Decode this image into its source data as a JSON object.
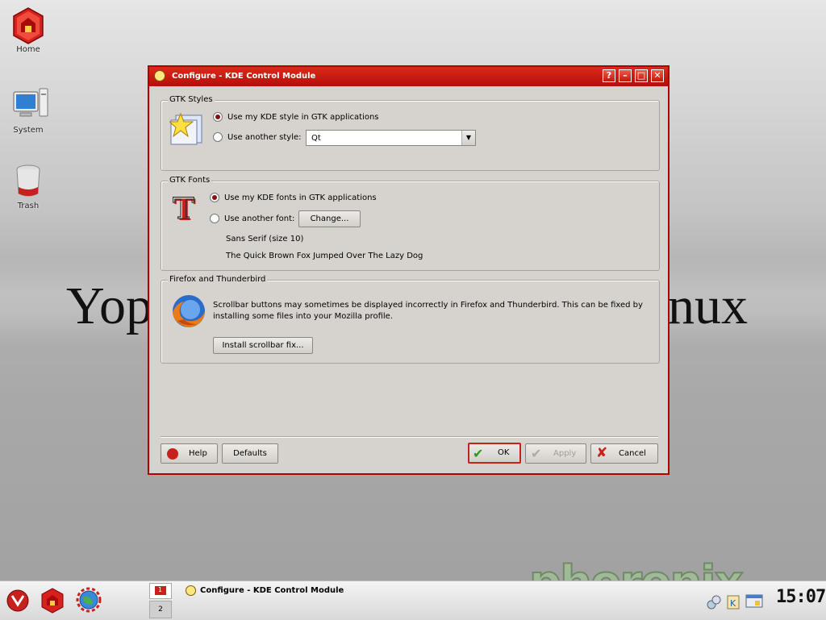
{
  "desktop": {
    "icons": [
      {
        "label": "Home",
        "icon": "home-icon"
      },
      {
        "label": "System",
        "icon": "computer-icon"
      },
      {
        "label": "Trash",
        "icon": "trash-icon"
      }
    ],
    "wallpaper_left": "Yop",
    "wallpaper_right": "nux",
    "brand": "phoronix"
  },
  "window": {
    "title": "Configure - KDE Control Module",
    "title_buttons": {
      "help": "?",
      "minimize": "–",
      "maximize": "□",
      "close": "✕"
    },
    "gtk_styles": {
      "legend": "GTK Styles",
      "option_kde": "Use my KDE style in GTK applications",
      "option_other": "Use another style:",
      "selected": "kde",
      "style_value": "Qt"
    },
    "gtk_fonts": {
      "legend": "GTK Fonts",
      "option_kde": "Use my KDE fonts in GTK applications",
      "option_other": "Use another font:",
      "selected": "kde",
      "change_label": "Change...",
      "font_name": "Sans Serif (size 10)",
      "preview": "The Quick Brown Fox Jumped Over The Lazy Dog"
    },
    "firefox": {
      "legend": "Firefox and Thunderbird",
      "message": "Scrollbar buttons may sometimes be displayed incorrectly in Firefox and Thunderbird.  This can be fixed by installing some files into your Mozilla profile.",
      "install_label": "Install scrollbar fix..."
    },
    "buttons": {
      "help": "Help",
      "defaults": "Defaults",
      "ok": "OK",
      "apply": "Apply",
      "cancel": "Cancel"
    }
  },
  "panel": {
    "desktop_numbers": [
      "1",
      "2"
    ],
    "task_title": "Configure - KDE Control Module",
    "clock": "15:07"
  }
}
